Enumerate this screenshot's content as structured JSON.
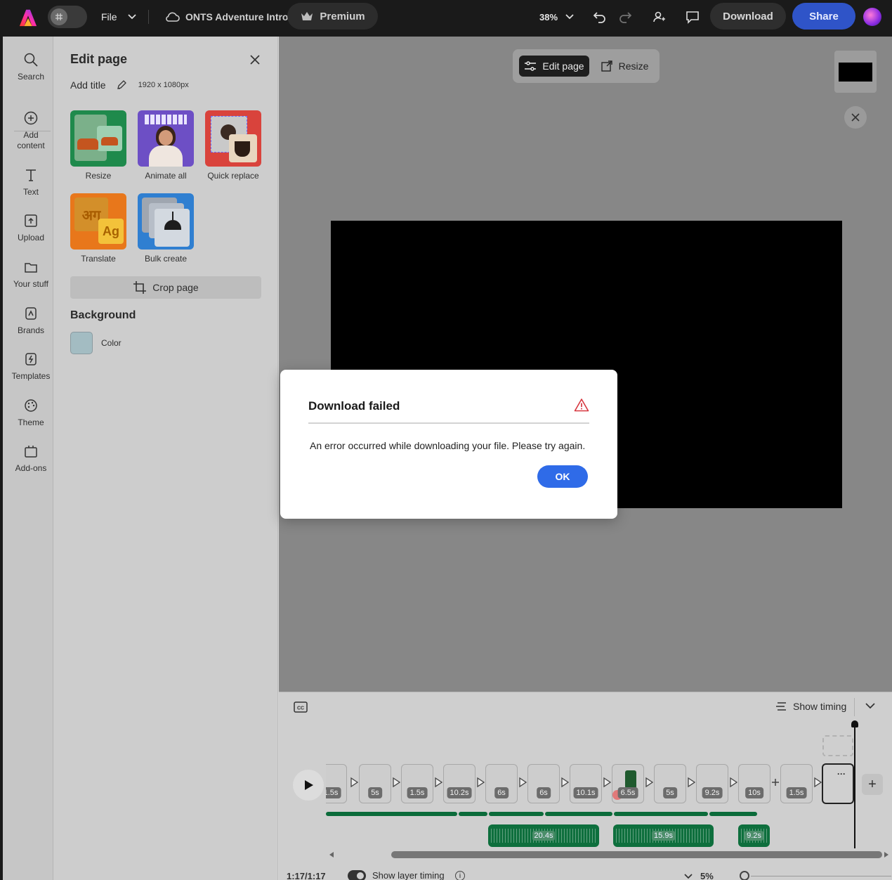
{
  "topbar": {
    "file_label": "File",
    "doc_title": "ONTS Adventure Intro",
    "premium_label": "Premium",
    "zoom_value": "38%",
    "download_label": "Download",
    "share_label": "Share",
    "accent_color": "#2f54c8"
  },
  "rail": {
    "items": [
      {
        "label": "Search",
        "icon": "search-icon"
      },
      {
        "label": "Add content",
        "icon": "plus-circle-icon"
      },
      {
        "label": "Text",
        "icon": "text-icon"
      },
      {
        "label": "Upload",
        "icon": "upload-icon"
      },
      {
        "label": "Your stuff",
        "icon": "folder-icon"
      },
      {
        "label": "Brands",
        "icon": "brands-icon"
      },
      {
        "label": "Templates",
        "icon": "templates-icon"
      },
      {
        "label": "Theme",
        "icon": "palette-icon"
      },
      {
        "label": "Add-ons",
        "icon": "addons-icon"
      }
    ]
  },
  "panel": {
    "title": "Edit page",
    "add_title": "Add title",
    "dimensions": "1920 x 1080px",
    "cards": [
      {
        "label": "Resize"
      },
      {
        "label": "Animate all"
      },
      {
        "label": "Quick replace"
      },
      {
        "label": "Translate"
      },
      {
        "label": "Bulk create"
      }
    ],
    "crop_label": "Crop page",
    "background_heading": "Background",
    "color_label": "Color",
    "background_color": "#a3bcc2"
  },
  "canvas": {
    "edit_page_label": "Edit page",
    "resize_label": "Resize"
  },
  "timeline": {
    "show_timing_label": "Show timing",
    "scene_durations": [
      "1.5s",
      "5s",
      "1.5s",
      "10.2s",
      "6s",
      "6s",
      "10.1s",
      "6.5s",
      "5s",
      "9.2s",
      "10s",
      "1.5s"
    ],
    "audio_clips": [
      "20.4s",
      "15.9s",
      "9.2s"
    ],
    "time_readout": "1:17/1:17",
    "layer_timing_label": "Show layer timing",
    "zoom_value": "5%"
  },
  "dialog": {
    "title": "Download failed",
    "message": "An error occurred while downloading your file. Please try again.",
    "ok_label": "OK",
    "warning_color": "#d7373f"
  }
}
